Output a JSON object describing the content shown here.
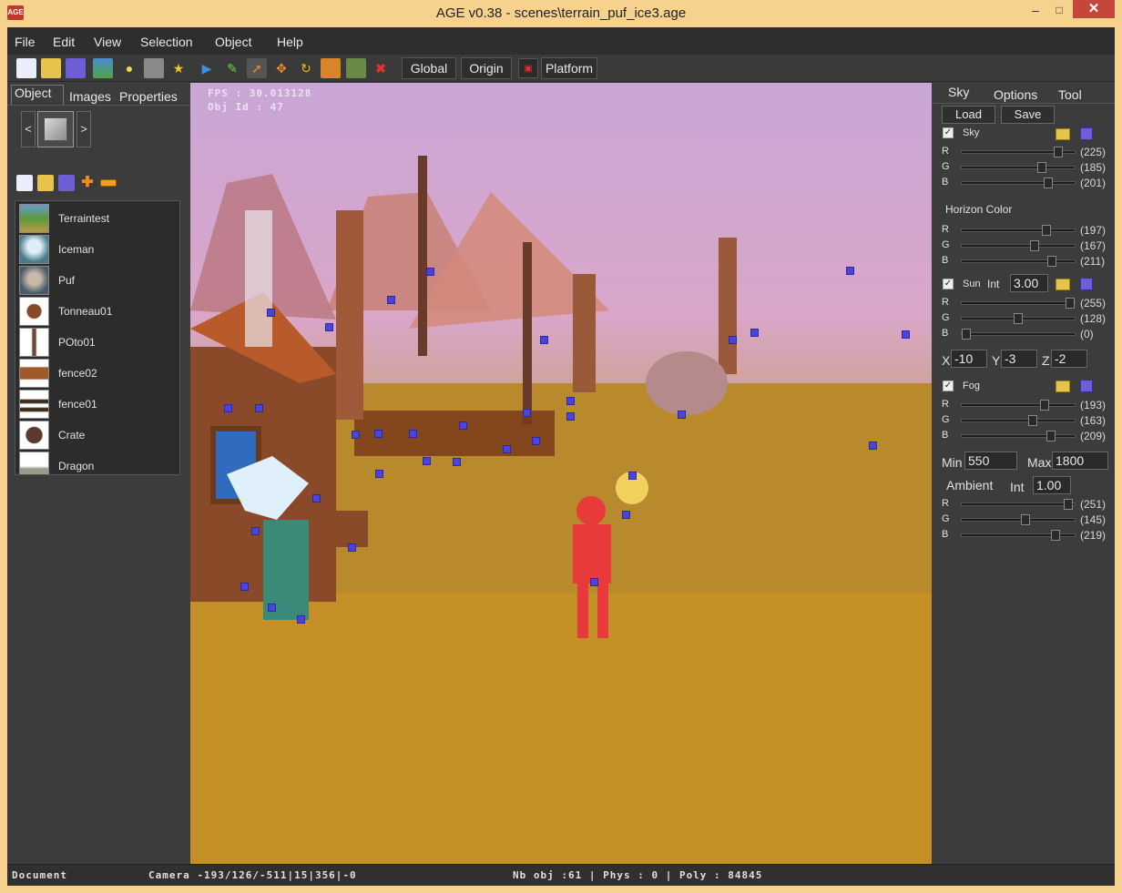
{
  "window": {
    "title": "AGE v0.38 - scenes\\terrain_puf_ice3.age",
    "app_icon": "AGE",
    "minimize": "‒",
    "maximize": "□",
    "close": "✕"
  },
  "menu": [
    "File",
    "Edit",
    "View",
    "Selection",
    "Object",
    "Help"
  ],
  "toolbar": {
    "icons": [
      "new-file-icon",
      "open-folder-icon",
      "save-icon",
      "terrain-icon",
      "light-bulb-icon",
      "camera-icon",
      "star-icon",
      "play-icon",
      "pencil-icon",
      "select-arrow-icon",
      "move-icon",
      "rotate-icon",
      "scale-icon",
      "image-icon",
      "delete-icon"
    ],
    "global_label": "Global",
    "origin_label": "Origin",
    "platform_label": "Platform"
  },
  "left": {
    "tabs": [
      "Object",
      "Images",
      "Properties"
    ],
    "prev": "<",
    "next": ">",
    "objects": [
      {
        "label": "Terraintest"
      },
      {
        "label": "Iceman"
      },
      {
        "label": "Puf"
      },
      {
        "label": "Tonneau01"
      },
      {
        "label": "POto01"
      },
      {
        "label": "fence02"
      },
      {
        "label": "fence01"
      },
      {
        "label": "Crate"
      },
      {
        "label": "Dragon"
      }
    ]
  },
  "viewport": {
    "fps": "FPS : 30.013128",
    "obj_id": "Obj Id : 47"
  },
  "right": {
    "tabs": [
      "Sky",
      "Options",
      "Tool"
    ],
    "load": "Load",
    "save": "Save",
    "sky": {
      "label": "Sky",
      "checked": "✓",
      "r": "(225)",
      "g": "(185)",
      "b": "(201)",
      "r_level": 225,
      "g_level": 185,
      "b_level": 201
    },
    "horizon": {
      "label": "Horizon Color",
      "r": "(197)",
      "g": "(167)",
      "b": "(211)",
      "r_level": 197,
      "g_level": 167,
      "b_level": 211
    },
    "sun": {
      "label": "Sun",
      "int_label": "Int",
      "int_value": "3.00",
      "checked": "✓",
      "r": "(255)",
      "g": "(128)",
      "b": "(0)",
      "r_level": 255,
      "g_level": 128,
      "b_level": 0
    },
    "pos": {
      "x_label": "X",
      "x": "-10",
      "y_label": "Y",
      "y": "-3",
      "z_label": "Z",
      "z": "-2"
    },
    "fog": {
      "label": "Fog",
      "checked": "✓",
      "r": "(193)",
      "g": "(163)",
      "b": "(209)",
      "r_level": 193,
      "g_level": 163,
      "b_level": 209
    },
    "range": {
      "min_label": "Min",
      "min": "550",
      "max_label": "Max",
      "max": "1800"
    },
    "ambient": {
      "label": "Ambient",
      "int_label": "Int",
      "int_value": "1.00",
      "r": "(251)",
      "g": "(145)",
      "b": "(219)",
      "r_level": 251,
      "g_level": 145,
      "b_level": 219
    },
    "channel_r": "R",
    "channel_g": "G",
    "channel_b": "B"
  },
  "status": {
    "document": "Document",
    "camera": "Camera -193/126/-511|15|356|-0",
    "stats": "Nb obj :61 | Phys : 0 | Poly : 84845"
  }
}
